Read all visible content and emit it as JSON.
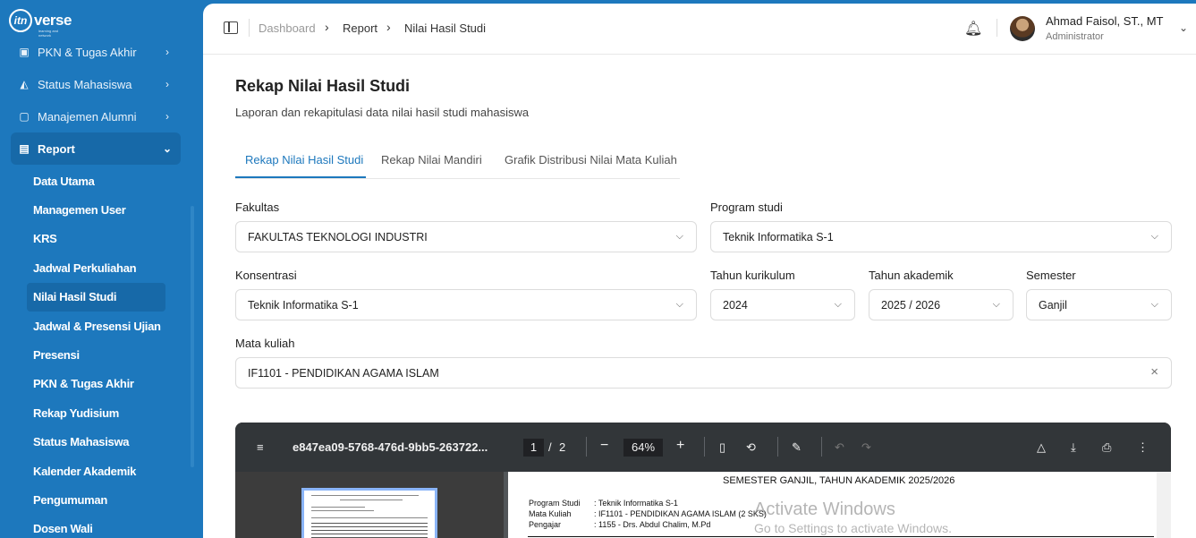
{
  "brand": {
    "logo_mark": "itn",
    "name": "verse",
    "tagline": "learning and network"
  },
  "sidebar": {
    "items": [
      {
        "label": "PKN & Tugas Akhir",
        "icon": "book-icon"
      },
      {
        "label": "Status Mahasiswa",
        "icon": "graduation-cap-icon"
      },
      {
        "label": "Manajemen Alumni",
        "icon": "folder-icon"
      },
      {
        "label": "Report",
        "icon": "report-icon"
      }
    ],
    "report_items": [
      "Data Utama",
      "Managemen User",
      "KRS",
      "Jadwal Perkuliahan",
      "Nilai Hasil Studi",
      "Jadwal & Presensi Ujian",
      "Presensi",
      "PKN & Tugas Akhir",
      "Rekap Yudisium",
      "Status Mahasiswa",
      "Kalender Akademik",
      "Pengumuman",
      "Dosen Wali"
    ]
  },
  "breadcrumb": {
    "root": "Dashboard",
    "mid": "Report",
    "current": "Nilai Hasil Studi"
  },
  "user": {
    "name": "Ahmad Faisol, ST., MT",
    "role": "Administrator"
  },
  "page": {
    "title": "Rekap Nilai Hasil Studi",
    "subtitle": "Laporan dan rekapitulasi data nilai hasil studi mahasiswa"
  },
  "tabs": [
    "Rekap Nilai Hasil Studi",
    "Rekap Nilai Mandiri",
    "Grafik Distribusi Nilai Mata Kuliah"
  ],
  "filters": {
    "fakultas_label": "Fakultas",
    "fakultas": "FAKULTAS TEKNOLOGI INDUSTRI",
    "prodi_label": "Program studi",
    "prodi": "Teknik Informatika S-1",
    "konsentrasi_label": "Konsentrasi",
    "konsentrasi": "Teknik Informatika S-1",
    "kurikulum_label": "Tahun kurikulum",
    "kurikulum": "2024",
    "akademik_label": "Tahun akademik",
    "akademik": "2025 / 2026",
    "semester_label": "Semester",
    "semester": "Ganjil",
    "matkul_label": "Mata kuliah",
    "matkul": "IF1101 - PENDIDIKAN AGAMA ISLAM"
  },
  "pdf": {
    "filename": "e847ea09-5768-476d-9bb5-263722...",
    "page": "1",
    "page_sep": "/",
    "total": "2",
    "zoom": "64%",
    "doc_title": "SEMESTER GANJIL, TAHUN AKADEMIK 2025/2026",
    "rows": [
      {
        "k": "Program Studi",
        "v": ": Teknik Informatika S-1"
      },
      {
        "k": "Mata Kuliah",
        "v": ": IF1101 - PENDIDIKAN AGAMA ISLAM  (2 SKS)"
      },
      {
        "k": "Pengajar",
        "v": ": 1155 - Drs. Abdul Chalim, M.Pd"
      }
    ]
  },
  "watermark": {
    "line1": "Activate Windows",
    "line2": "Go to Settings to activate Windows."
  }
}
